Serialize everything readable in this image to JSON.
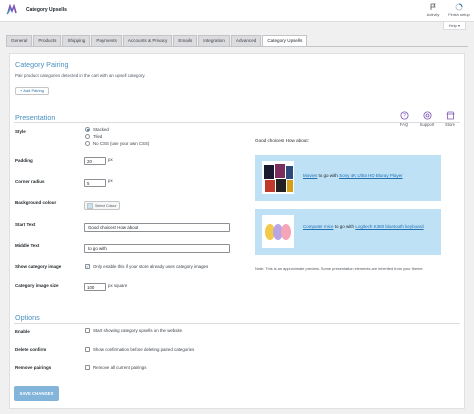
{
  "header": {
    "title": "Category Upsells",
    "activity_label": "Activity",
    "finish_setup_label": "Finish setup",
    "help_label": "Help ▾",
    "logo_icon": "woocommerce-logo-icon",
    "activity_icon": "flag-icon",
    "setup_icon": "progress-ring-icon"
  },
  "tabs": [
    {
      "label": "General"
    },
    {
      "label": "Products"
    },
    {
      "label": "Shipping"
    },
    {
      "label": "Payments"
    },
    {
      "label": "Accounts & Privacy"
    },
    {
      "label": "Emails"
    },
    {
      "label": "Integration"
    },
    {
      "label": "Advanced"
    },
    {
      "label": "Category Upsells",
      "active": true
    }
  ],
  "pairing": {
    "title": "Category Pairing",
    "subtitle": "Pair product categories detected in the cart with an upsell category.",
    "add_button": "+ Add Pairing"
  },
  "side_links": [
    {
      "label": "FAQ",
      "icon": "question-circle-icon"
    },
    {
      "label": "Support",
      "icon": "lifebuoy-icon"
    },
    {
      "label": "Store",
      "icon": "store-icon"
    }
  ],
  "presentation": {
    "title": "Presentation",
    "style_label": "Style",
    "style_options": [
      "Stacked",
      "Tiled",
      "No CSS (use your own CSS)"
    ],
    "style_selected": 0,
    "padding_label": "Padding",
    "padding_value": "20",
    "padding_unit": "px",
    "radius_label": "Corner radius",
    "radius_value": "5",
    "radius_unit": "px",
    "bg_label": "Background colour",
    "bg_button": "Select Colour",
    "bg_color": "#c8e2f4",
    "start_label": "Start Text",
    "start_value": "Good choices! How about",
    "middle_label": "Middle Text",
    "middle_value": "to go with",
    "show_image_label": "Show category image",
    "show_image_text": "Only enable this if your store already uses category images",
    "show_image_checked": true,
    "image_size_label": "Category image size",
    "image_size_value": "100",
    "image_size_unit": "px square"
  },
  "preview": {
    "heading": "Good choices! How about:",
    "card_color": "#bfe1f6",
    "cards": [
      {
        "category": "Movies",
        "middle": "to go with",
        "product": "Sony 4K Ultra HD Bluray Player",
        "image": "movie-covers-image"
      },
      {
        "category": "Computer mice",
        "middle": "to go with",
        "product": "Logitech K380 bluetooth keyboard",
        "image": "computer-mice-image"
      }
    ],
    "note": "Note: This is an approximate preview. Some presentation elements are inherited from your theme."
  },
  "options": {
    "title": "Options",
    "enable_label": "Enable",
    "enable_text": "Start showing category upsells on the website",
    "delete_label": "Delete confirm",
    "delete_text": "Show confirmation before deleting paired categories",
    "remove_label": "Remove pairings",
    "remove_text": "Remove all current pairings"
  },
  "save_button": "SAVE CHANGES",
  "colors": {
    "accent": "#4a90c2",
    "link": "#2271b1",
    "save_disabled": "#82b5d9"
  }
}
